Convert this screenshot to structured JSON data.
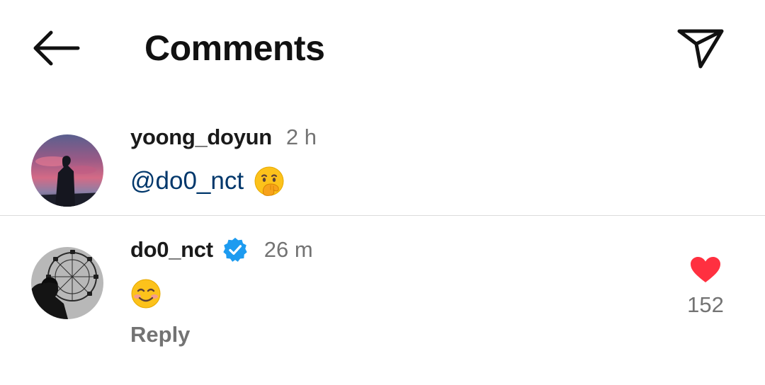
{
  "header": {
    "title": "Comments",
    "back_icon": "arrow-left-icon",
    "share_icon": "paper-plane-icon"
  },
  "comments": [
    {
      "username": "yoong_doyun",
      "time": "2 h",
      "text": "@do0_nct",
      "emoji": "face-with-hand-over-mouth",
      "avatar": "sunset-silhouette-avatar"
    },
    {
      "username": "do0_nct",
      "verified": true,
      "time": "26 m",
      "emoji": "smiling-face",
      "reply_label": "Reply",
      "likes": "152",
      "avatar": "ferris-wheel-avatar"
    }
  ],
  "colors": {
    "mention": "#00376b",
    "secondary_text": "#737373",
    "verified_blue": "#1d9bf0",
    "like_red": "#ff3040",
    "divider": "#dcdcdc"
  }
}
